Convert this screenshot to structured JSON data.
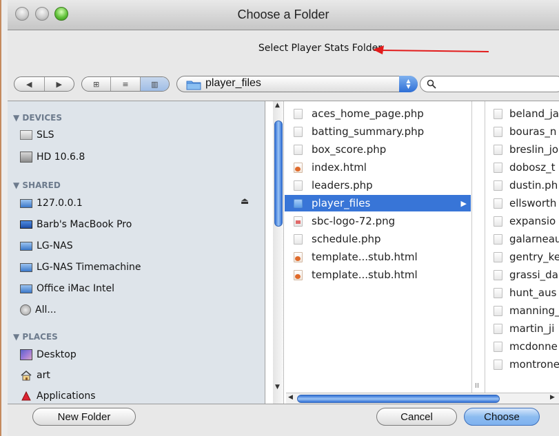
{
  "window": {
    "title": "Choose a Folder"
  },
  "prompt": "Select Player Stats Folder",
  "toolbar": {
    "back_icon": "◀",
    "forward_icon": "▶",
    "view_icons": "⊞",
    "view_list": "≡",
    "view_columns": "▥",
    "path_popup": "player_files",
    "stepper_up": "▲",
    "stepper_down": "▼",
    "search_icon": "🔍",
    "search_value": ""
  },
  "sidebar": {
    "sections": [
      {
        "header": "▼ DEVICES",
        "items": [
          {
            "label": "SLS",
            "icon": "drive-icon"
          },
          {
            "label": "HD 10.6.8",
            "icon": "hard-drive-icon"
          }
        ]
      },
      {
        "header": "▼ SHARED",
        "items": [
          {
            "label": "127.0.0.1",
            "icon": "monitor-icon"
          },
          {
            "label": "Barb's MacBook Pro",
            "icon": "laptop-icon"
          },
          {
            "label": "LG-NAS",
            "icon": "monitor-icon"
          },
          {
            "label": "LG-NAS Timemachine",
            "icon": "monitor-icon"
          },
          {
            "label": "Office iMac Intel",
            "icon": "monitor-icon"
          },
          {
            "label": "All...",
            "icon": "globe-icon"
          }
        ]
      },
      {
        "header": "▼ PLACES",
        "items": [
          {
            "label": "Desktop",
            "icon": "desktop-icon"
          },
          {
            "label": "art",
            "icon": "home-icon"
          },
          {
            "label": "Applications",
            "icon": "applications-icon"
          }
        ]
      }
    ],
    "eject": "⏏"
  },
  "column1": [
    {
      "name": "aces_home_page.php",
      "kind": "php"
    },
    {
      "name": "batting_summary.php",
      "kind": "php"
    },
    {
      "name": "box_score.php",
      "kind": "php"
    },
    {
      "name": "index.html",
      "kind": "html"
    },
    {
      "name": "leaders.php",
      "kind": "php"
    },
    {
      "name": "player_files",
      "kind": "folder",
      "selected": true
    },
    {
      "name": "sbc-logo-72.png",
      "kind": "png"
    },
    {
      "name": "schedule.php",
      "kind": "php"
    },
    {
      "name": "template...stub.html",
      "kind": "html"
    },
    {
      "name": "template...stub.html",
      "kind": "html"
    }
  ],
  "column2": [
    "beland_ja",
    "bouras_n",
    "breslin_jo",
    "dobosz_t",
    "dustin.ph",
    "ellsworth",
    "expansio",
    "galarneau",
    "gentry_ke",
    "grassi_da",
    "hunt_aus",
    "manning_",
    "martin_ji",
    "mcdonne",
    "montrone"
  ],
  "footer": {
    "new_folder": "New Folder",
    "cancel": "Cancel",
    "choose": "Choose"
  },
  "colors": {
    "selection": "#3875d7",
    "accent_arrow": "#e21b1b"
  }
}
